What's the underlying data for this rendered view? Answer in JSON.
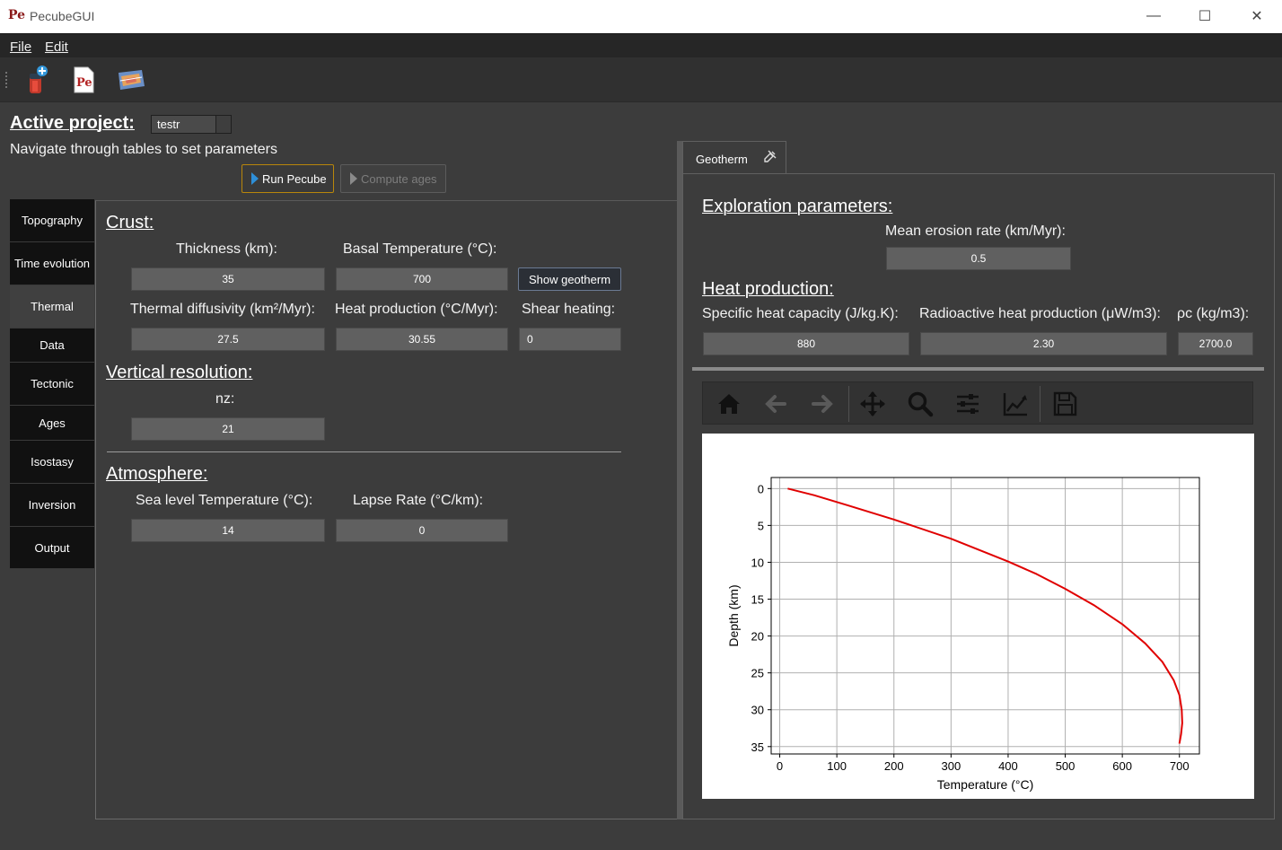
{
  "window": {
    "logo": "Pe",
    "title": "PecubeGUI",
    "controls": {
      "minimize": "—",
      "maximize": "☐",
      "close": "✕"
    }
  },
  "menu": {
    "file": "File",
    "edit": "Edit"
  },
  "toolbar": {
    "icons": [
      "new-project-icon",
      "pecube-icon",
      "map-icon"
    ],
    "pecube_icon_text": "Pe"
  },
  "project": {
    "label": "Active project:",
    "name": "testr",
    "hint": "Navigate through tables to set parameters"
  },
  "actions": {
    "run": "Run Pecube",
    "compute": "Compute ages"
  },
  "tabs": [
    {
      "label": "Topography"
    },
    {
      "label": "Time evolution"
    },
    {
      "label": "Thermal",
      "active": true
    },
    {
      "label": "Data"
    },
    {
      "label": "Tectonic"
    },
    {
      "label": "Ages"
    },
    {
      "label": "Isostasy"
    },
    {
      "label": "Inversion"
    },
    {
      "label": "Output"
    }
  ],
  "thermal": {
    "crust": {
      "title": "Crust:",
      "thickness_label": "Thickness (km):",
      "thickness": "35",
      "basal_temp_label": "Basal Temperature (°C):",
      "basal_temp": "700",
      "show_geotherm": "Show geotherm",
      "diffusivity_label": "Thermal diffusivity (km²/Myr):",
      "diffusivity": "27.5",
      "heat_prod_label": "Heat production (°C/Myr):",
      "heat_prod": "30.55",
      "shear_label": "Shear heating:",
      "shear": "0"
    },
    "vertical": {
      "title": "Vertical resolution:",
      "nz_label": "nz:",
      "nz": "21"
    },
    "atmosphere": {
      "title": "Atmosphere:",
      "sea_temp_label": "Sea level Temperature (°C):",
      "sea_temp": "14",
      "lapse_label": "Lapse Rate (°C/km):",
      "lapse": "0"
    }
  },
  "geotherm": {
    "tab": "Geotherm",
    "exploration_title": "Exploration parameters:",
    "erosion_label": "Mean erosion rate (km/Myr):",
    "erosion": "0.5",
    "heat_title": "Heat production:",
    "cp_label": "Specific heat capacity (J/kg.K):",
    "cp": "880",
    "rhp_label": "Radioactive heat production (μW/m3):",
    "rhp": "2.30",
    "rho_label": "ρc (kg/m3):",
    "rho": "2700.0"
  },
  "mpl_toolbar": [
    "home-icon",
    "back-icon",
    "forward-icon",
    "pan-icon",
    "zoom-icon",
    "configure-subplots-icon",
    "edit-axis-icon",
    "save-icon"
  ],
  "chart_data": {
    "type": "line",
    "title": "",
    "xlabel": "Temperature (°C)",
    "ylabel": "Depth (km)",
    "xlim": [
      -15,
      735
    ],
    "ylim": [
      36,
      -1.5
    ],
    "y_inverted": true,
    "grid": true,
    "xticks": [
      0,
      100,
      200,
      300,
      400,
      500,
      600,
      700
    ],
    "yticks": [
      0,
      5,
      10,
      15,
      20,
      25,
      30,
      35
    ],
    "series": [
      {
        "color": "#e00000",
        "x": [
          14,
          60,
          120,
          200,
          300,
          400,
          450,
          500,
          550,
          600,
          640,
          670,
          690,
          700,
          704,
          705,
          703,
          700
        ],
        "y": [
          0,
          0.9,
          2.3,
          4.2,
          6.8,
          9.9,
          11.6,
          13.6,
          15.8,
          18.4,
          21.0,
          23.5,
          26.0,
          28.0,
          30.0,
          31.8,
          33.3,
          34.6
        ]
      }
    ]
  }
}
